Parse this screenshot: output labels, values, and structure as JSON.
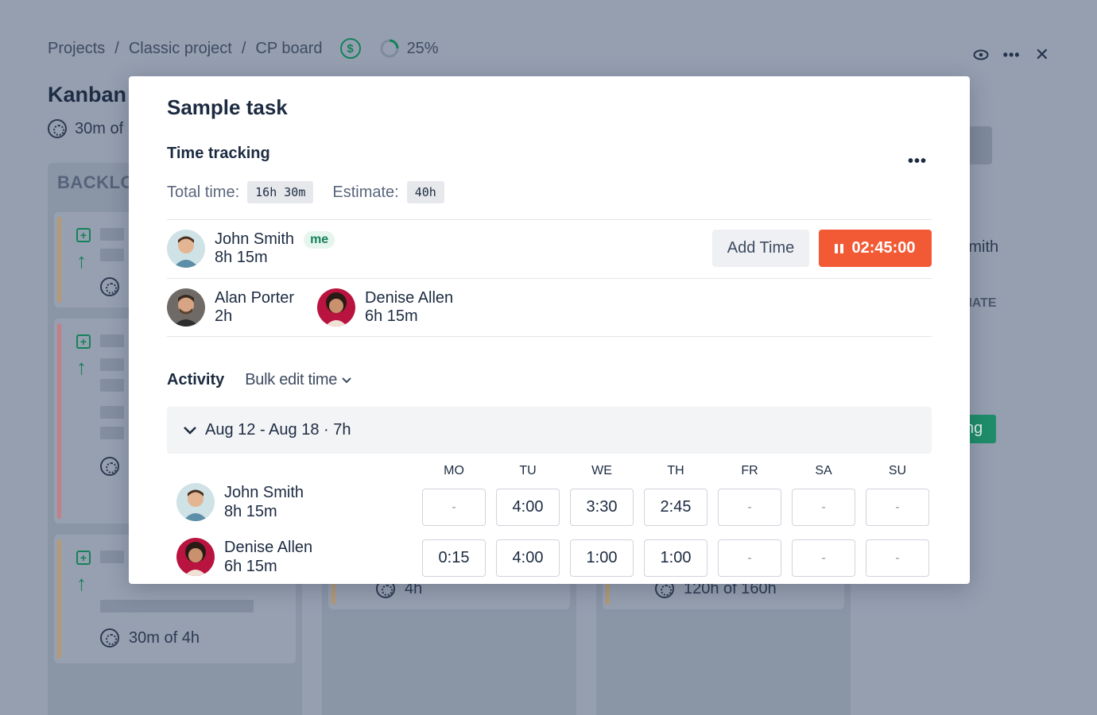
{
  "breadcrumb": [
    "Projects",
    "Classic project",
    "CP board"
  ],
  "breadcrumb_sep": "/",
  "progress": {
    "label": "25%",
    "fraction": 0.25
  },
  "board": {
    "title": "Kanban b",
    "subtitle": "30m of",
    "backlog_title": "BACKLOG",
    "card3_meta": "30m of 4h",
    "col2_meta": "4h",
    "col3_meta": "120h of 160h",
    "right_name": "Smith",
    "right_label": "IMATE",
    "right_green": "ng"
  },
  "modal": {
    "title": "Sample task",
    "section": "Time tracking",
    "more": "•••",
    "total_label": "Total time:",
    "total_value": "16h 30m",
    "estimate_label": "Estimate:",
    "estimate_value": "40h",
    "current_user": {
      "name": "John Smith",
      "badge": "me",
      "time": "8h 15m"
    },
    "add_time": "Add Time",
    "timer": "02:45:00",
    "others": [
      {
        "name": "Alan Porter",
        "time": "2h"
      },
      {
        "name": "Denise Allen",
        "time": "6h 15m"
      }
    ],
    "activity_label": "Activity",
    "bulk_edit": "Bulk edit time",
    "week_label": "Aug 12 - Aug 18 · 7h",
    "days": [
      "MO",
      "TU",
      "WE",
      "TH",
      "FR",
      "SA",
      "SU"
    ],
    "rows": [
      {
        "name": "John Smith",
        "time": "8h 15m",
        "values": [
          "-",
          "4:00",
          "3:30",
          "2:45",
          "-",
          "-",
          "-"
        ]
      },
      {
        "name": "Denise Allen",
        "time": "6h 15m",
        "values": [
          "0:15",
          "4:00",
          "1:00",
          "1:00",
          "-",
          "-",
          "-"
        ]
      }
    ]
  },
  "colors": {
    "accent_green": "#16815a",
    "timer_red": "#f25a35",
    "title_dark": "#1c2b41"
  }
}
